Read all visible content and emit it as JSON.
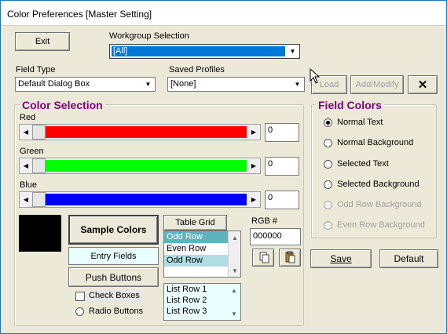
{
  "window": {
    "title": "Color Preferences [Master Setting]"
  },
  "buttons": {
    "exit": "Exit",
    "load": "Load",
    "add_modify": "Add/Modify",
    "close": "✕",
    "save": "Save",
    "default": "Default",
    "sample_colors": "Sample Colors",
    "push_buttons": "Push Buttons",
    "table_grid": "Table Grid"
  },
  "labels": {
    "workgroup": "Workgroup Selection",
    "field_type": "Field Type",
    "saved_profiles": "Saved Profiles",
    "red": "Red",
    "green": "Green",
    "blue": "Blue",
    "rgb": "RGB #",
    "entry_fields": "Entry Fields",
    "check_boxes": "Check Boxes",
    "radio_buttons": "Radio Buttons"
  },
  "combos": {
    "workgroup": "[All]",
    "field_type": "Default Dialog Box",
    "saved_profiles": "[None]"
  },
  "color_selection": {
    "legend": "Color Selection",
    "red_value": "0",
    "green_value": "0",
    "blue_value": "0",
    "rgb_value": "000000"
  },
  "field_colors": {
    "legend": "Field Colors",
    "options": [
      {
        "label": "Normal Text",
        "checked": true,
        "enabled": true
      },
      {
        "label": "Normal Background",
        "checked": false,
        "enabled": true
      },
      {
        "label": "Selected Text",
        "checked": false,
        "enabled": true
      },
      {
        "label": "Selected Background",
        "checked": false,
        "enabled": true
      },
      {
        "label": "Odd Row Background",
        "checked": false,
        "enabled": false
      },
      {
        "label": "Even Row Background",
        "checked": false,
        "enabled": false
      }
    ]
  },
  "table_grid_rows": [
    "Odd Row",
    "Even Row",
    "Odd Row"
  ],
  "list_rows": [
    "List Row 1",
    "List Row 2",
    "List Row 3"
  ],
  "colors": {
    "red": "#ff0000",
    "green": "#00ff00",
    "blue": "#0000ff",
    "legend": "#800080",
    "sample_swatch": "#000000",
    "selection": "#0078d7",
    "odd_row": "#b0dde4",
    "odd_row_selected": "#5fb3c0",
    "entry_bg": "#e9ffff"
  },
  "icons": {
    "copy": "copy-icon",
    "paste": "paste-icon"
  }
}
